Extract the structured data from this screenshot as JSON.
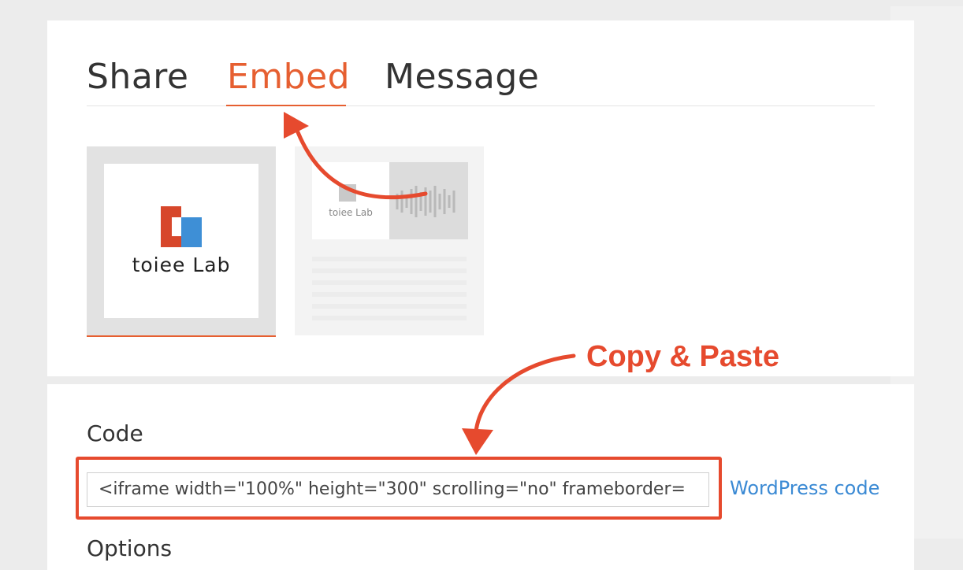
{
  "tabs": [
    {
      "label": "Share",
      "active": false
    },
    {
      "label": "Embed",
      "active": true
    },
    {
      "label": "Message",
      "active": false
    }
  ],
  "thumbnails": {
    "square": {
      "logo_text": "toiee Lab",
      "selected": true
    },
    "wide": {
      "logo_text": "toiee Lab",
      "selected": false
    }
  },
  "code_section": {
    "label": "Code",
    "input_value": "<iframe width=\"100%\" height=\"300\" scrolling=\"no\" frameborder=",
    "wordpress_link": "WordPress code"
  },
  "options_section": {
    "label": "Options"
  },
  "annotation": {
    "text": "Copy & Paste"
  },
  "colors": {
    "accent": "#e65f31",
    "annotation": "#e64a2e",
    "link": "#3b8ad4"
  }
}
